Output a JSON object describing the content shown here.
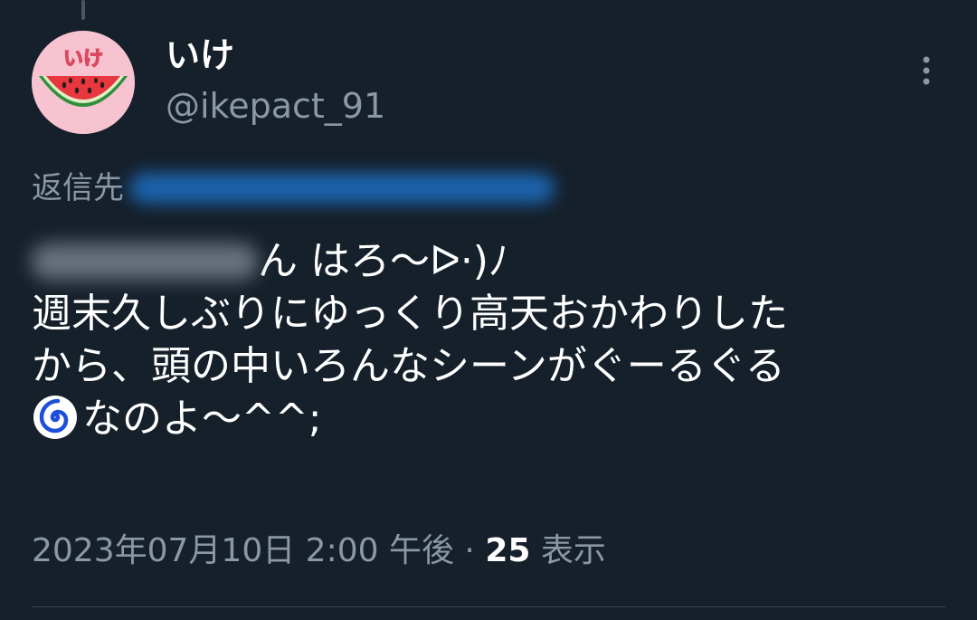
{
  "tweet": {
    "author": {
      "display_name": "いけ",
      "handle": "@ikepact_91",
      "avatar_text": "いけ"
    },
    "reply_to_label": "返信先",
    "body_lines": [
      "ん はろ〜ᐅ·)ﾉ",
      "週末久しぶりにゆっくり高天おかわりした",
      "から、頭の中いろんなシーンがぐーるぐる",
      "なのよ〜^^;"
    ],
    "timestamp": "2023年07月10日 2:00 午後",
    "separator": "·",
    "views_count": "25",
    "views_label": "表示"
  },
  "colors": {
    "background": "#15202b",
    "text_primary": "#ffffff",
    "text_secondary": "#8b98a5",
    "avatar_bg": "#f7c3d0",
    "spiral": "#1d4fd8"
  },
  "icons": {
    "more": "more-vertical-icon",
    "spiral": "spiral-emoji-icon",
    "avatar_art": "watermelon-icon"
  }
}
